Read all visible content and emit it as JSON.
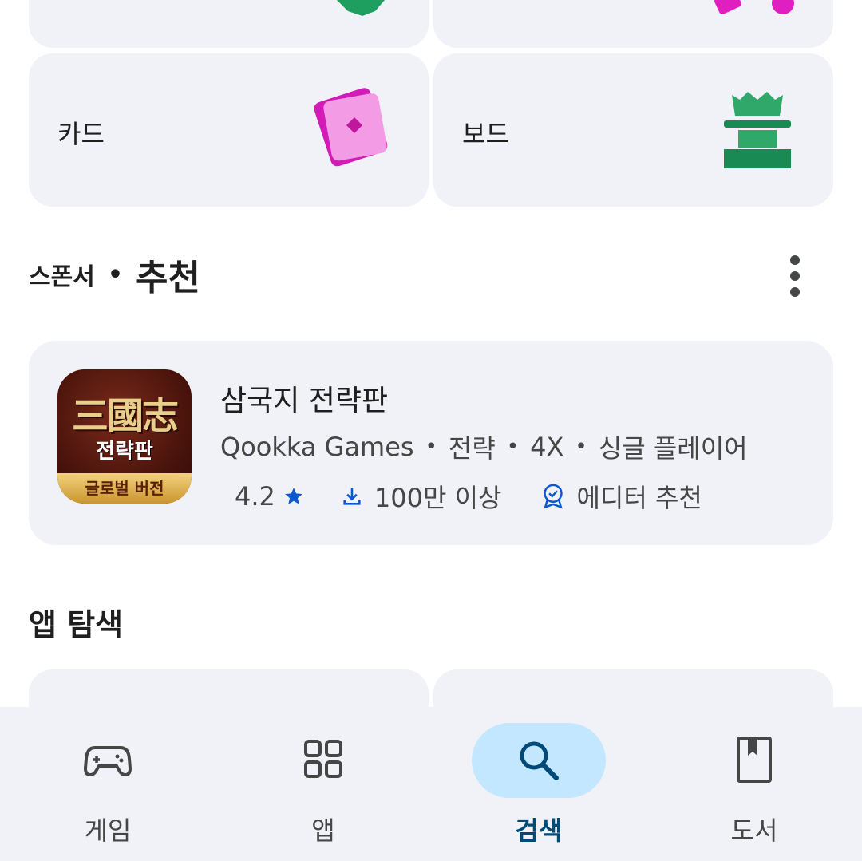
{
  "categories": [
    {
      "label": "",
      "icon": "green-block-icon"
    },
    {
      "label": "",
      "icon": "pink-shapes-icon"
    },
    {
      "label": "카드",
      "icon": "card-icon"
    },
    {
      "label": "보드",
      "icon": "chess-rook-icon"
    }
  ],
  "sponsored_section": {
    "sponsor_label": "스폰서",
    "separator": "•",
    "title": "추천",
    "more_icon": "more-vert-icon"
  },
  "app": {
    "name": "삼국지 전략판",
    "icon_text_han": "三國志",
    "icon_text_kr": "전략판",
    "icon_banner": "글로벌 버전",
    "developer": "Qookka Games",
    "tags": [
      "전략",
      "4X",
      "싱글 플레이어"
    ],
    "meta_separator": "•",
    "rating": "4.2",
    "downloads": "100만 이상",
    "badge": "에디터 추천"
  },
  "explore": {
    "title": "앱 탐색"
  },
  "bottom_nav": {
    "active_index": 2,
    "items": [
      {
        "label": "게임",
        "icon": "gamepad-icon"
      },
      {
        "label": "앱",
        "icon": "apps-grid-icon"
      },
      {
        "label": "검색",
        "icon": "search-icon"
      },
      {
        "label": "도서",
        "icon": "book-icon"
      }
    ]
  },
  "colors": {
    "tile_bg": "#f0f2f8",
    "active_pill": "#c2e7ff",
    "active_label": "#004a77",
    "star_blue": "#0b57d0"
  }
}
